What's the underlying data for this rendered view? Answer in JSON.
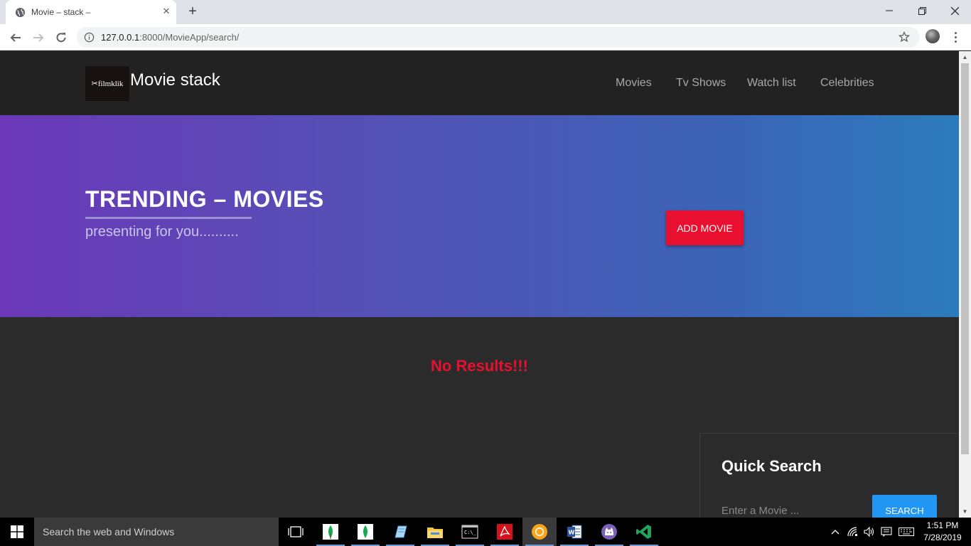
{
  "browser": {
    "tab_title": "Movie – stack –",
    "url_host": "127.0.0.1",
    "url_path": ":8000/MovieApp/search/"
  },
  "site": {
    "logo_text": "✂filmklik",
    "brand": "Movie stack",
    "nav": [
      "Movies",
      "Tv Shows",
      "Watch list",
      "Celebrities"
    ]
  },
  "hero": {
    "title": "TRENDING – MOVIES",
    "subtitle": "presenting for you..........",
    "add_button": "ADD MOVIE"
  },
  "content": {
    "no_results": "No Results!!!"
  },
  "quick_search": {
    "title": "Quick Search",
    "placeholder": "Enter a Movie ...",
    "button": "SEARCH"
  },
  "taskbar": {
    "search_placeholder": "Search the web and Windows",
    "apps": [
      "task-view",
      "mongodb",
      "mongodb-compass",
      "notepad",
      "file-explorer",
      "command-prompt",
      "acrobat-reader",
      "chrome",
      "word",
      "github-desktop",
      "visual-studio-code"
    ],
    "time": "1:51 PM",
    "date": "7/28/2019"
  },
  "colors": {
    "accent_red": "#e8102e",
    "search_blue": "#2196f3",
    "navbar_bg": "#222222",
    "hero_gradient_start": "#6a38b8",
    "hero_gradient_end": "#2c7bbc"
  }
}
